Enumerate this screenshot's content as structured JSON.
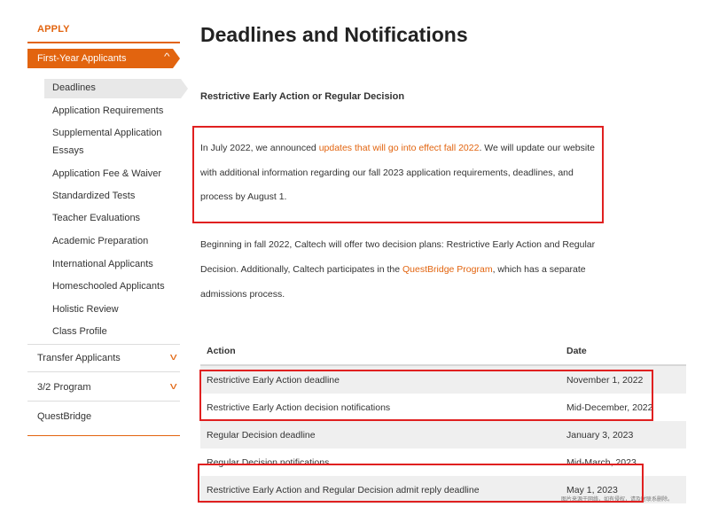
{
  "sidebar": {
    "apply_label": "APPLY",
    "active_section": "First-Year Applicants",
    "sub_items": [
      {
        "label": "Deadlines"
      },
      {
        "label": "Application Requirements"
      },
      {
        "label": "Supplemental Application"
      },
      {
        "label": "Essays"
      },
      {
        "label": "Application Fee & Waiver"
      },
      {
        "label": "Standardized Tests"
      },
      {
        "label": "Teacher Evaluations"
      },
      {
        "label": "Academic Preparation"
      },
      {
        "label": "International Applicants"
      },
      {
        "label": "Homeschooled Applicants"
      },
      {
        "label": "Holistic Review"
      },
      {
        "label": "Class Profile"
      }
    ],
    "sections": [
      {
        "label": "Transfer Applicants"
      },
      {
        "label": "3/2 Program"
      },
      {
        "label": "QuestBridge"
      }
    ]
  },
  "main": {
    "title": "Deadlines and Notifications",
    "subheading": "Restrictive Early Action or Regular Decision",
    "para1": {
      "l1_prefix": "In July 2022, we announced ",
      "l1_link": "updates that will go into effect fall 2022",
      "l1_suffix": ". We will update our website",
      "l2": "with additional information regarding our fall 2023 application requirements, deadlines, and",
      "l3": "process by August 1."
    },
    "para2": {
      "l1": "Beginning in fall 2022, Caltech will offer two decision plans: Restrictive Early Action and Regular",
      "l2_prefix": "Decision. Additionally, Caltech participates in the ",
      "l2_link": "QuestBridge Program",
      "l2_suffix": ", which has a separate",
      "l3": "admissions process."
    },
    "table": {
      "headers": {
        "action": "Action",
        "date": "Date"
      },
      "rows": [
        {
          "action": "Restrictive Early Action deadline",
          "date": "November 1, 2022"
        },
        {
          "action": "Restrictive Early Action decision notifications",
          "date": "Mid-December, 2022"
        },
        {
          "action": "Regular Decision deadline",
          "date": "January 3, 2023"
        },
        {
          "action": "Regular Decision notifications",
          "date": "Mid-March, 2023"
        },
        {
          "action": "Restrictive Early Action and Regular Decision admit reply deadline",
          "date": "May 1, 2023"
        }
      ]
    },
    "watermark": "图片来源于网络，如有侵权，请及时联系删除。"
  },
  "colors": {
    "accent": "#e2640f",
    "highlight": "#e02020",
    "row_shade": "#efefef"
  },
  "icons": {
    "expanded": "chevron-up-icon",
    "collapsed": "chevron-down-icon"
  }
}
